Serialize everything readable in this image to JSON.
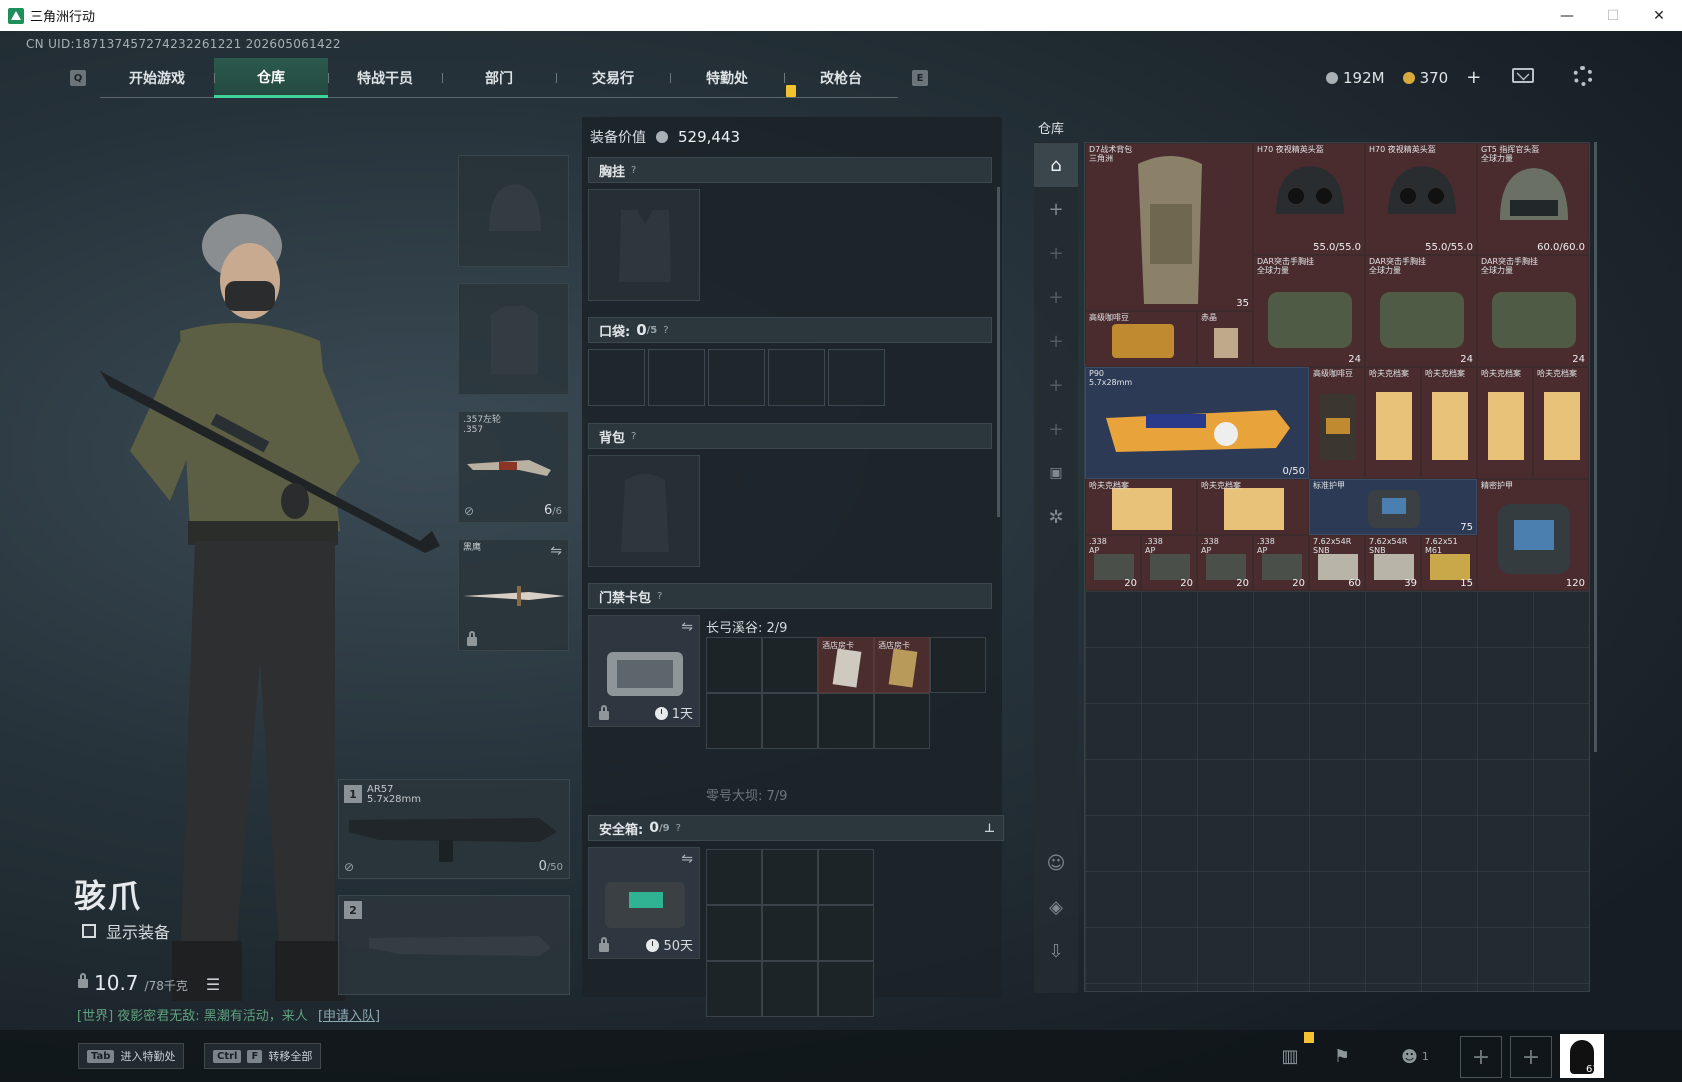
{
  "window": {
    "title": "三角洲行动",
    "controls": [
      "—",
      "☐",
      "✕"
    ]
  },
  "uid": "CN UID:187137457274232261221 202605061422",
  "nav": {
    "left_key": "Q",
    "right_key": "E",
    "tabs": [
      {
        "label": "开始游戏",
        "active": false
      },
      {
        "label": "仓库",
        "active": true
      },
      {
        "label": "特战干员",
        "active": false
      },
      {
        "label": "部门",
        "active": false
      },
      {
        "label": "交易行",
        "active": false
      },
      {
        "label": "特勤处",
        "active": false
      },
      {
        "label": "改枪台",
        "active": false
      }
    ]
  },
  "currency": {
    "hafcoin": "192M",
    "coupon": "370",
    "coupon_add": "+"
  },
  "character": {
    "name": "骇爪",
    "show_equipment": "显示装备",
    "weight": "10.7",
    "weight_max": "/78千克"
  },
  "chat": {
    "channel": "[世界]",
    "message": "夜影密君无敌: 黑潮有活动，来人",
    "link": "[申请入队]"
  },
  "equipment": {
    "pistol": {
      "name": ".357左轮",
      "sub": ".357",
      "ammo": "6",
      "ammo_max": "/6"
    },
    "melee": {
      "name": "黑鹰"
    },
    "primary": {
      "slot": "1",
      "name": "AR57",
      "caliber": "5.7x28mm",
      "ammo": "0",
      "ammo_max": "/50"
    },
    "secondary": {
      "slot": "2"
    }
  },
  "loadout": {
    "value_label": "装备价值",
    "value": "529,443",
    "sections": {
      "chest_rig": "胸挂",
      "pockets": "口袋: ",
      "pockets_count": "0",
      "pockets_max": "/5",
      "backpack": "背包",
      "keycard": "门禁卡包",
      "safebox": "安全箱: ",
      "safebox_count": "0",
      "safebox_max": "/9"
    },
    "keycard_case": {
      "duration": "1天"
    },
    "key_groups": [
      {
        "label": "长弓溪谷: 2/9"
      },
      {
        "label": "零号大坝: 7/9"
      }
    ],
    "keys": [
      {
        "label": "酒店房卡"
      },
      {
        "label": "酒店房卡"
      }
    ],
    "safebox_duration": "50天",
    "help": "?"
  },
  "warehouse": {
    "title": "仓库",
    "items": [
      {
        "label": "D7战术背包",
        "sub": "三角洲",
        "qty": "35"
      },
      {
        "label": "H70 夜视精英头盔",
        "qty": "55.0/55.0"
      },
      {
        "label": "H70 夜视精英头盔",
        "qty": "55.0/55.0"
      },
      {
        "label": "GT5 指挥官头盔",
        "sub": "全球力量",
        "qty": "60.0/60.0"
      },
      {
        "label": "DAR突击手胸挂",
        "sub": "全球力量",
        "qty": "24"
      },
      {
        "label": "DAR突击手胸挂",
        "sub": "全球力量",
        "qty": "24"
      },
      {
        "label": "DAR突击手胸挂",
        "sub": "全球力量",
        "qty": "24"
      },
      {
        "label": "高级咖啡豆",
        "qty": ""
      },
      {
        "label": "赤晶",
        "qty": ""
      },
      {
        "label": "P90",
        "sub": "5.7x28mm",
        "qty": "0/50"
      },
      {
        "label": "高级咖啡豆",
        "qty": ""
      },
      {
        "label": "哈夫克档案",
        "qty": ""
      },
      {
        "label": "哈夫克档案",
        "qty": ""
      },
      {
        "label": "哈夫克档案",
        "qty": ""
      },
      {
        "label": "哈夫克档案",
        "qty": ""
      },
      {
        "label": "哈夫克档案",
        "qty": ""
      },
      {
        "label": "哈夫克档案",
        "qty": ""
      },
      {
        "label": "标准护甲",
        "qty": "75"
      },
      {
        "label": "精密护甲",
        "qty": "120"
      },
      {
        "label": ".338",
        "sub": "AP",
        "qty": "20"
      },
      {
        "label": ".338",
        "sub": "AP",
        "qty": "20"
      },
      {
        "label": ".338",
        "sub": "AP",
        "qty": "20"
      },
      {
        "label": ".338",
        "sub": "AP",
        "qty": "20"
      },
      {
        "label": "7.62x54R",
        "sub": "SNB",
        "qty": "60"
      },
      {
        "label": "7.62x54R",
        "sub": "SNB",
        "qty": "39"
      },
      {
        "label": "7.62x51",
        "sub": "M61",
        "qty": "15"
      }
    ]
  },
  "bottom": {
    "hint1_key": "Tab",
    "hint1": "进入特勤处",
    "hint2_key1": "Ctrl",
    "hint2_key2": "F",
    "hint2": "转移全部",
    "friends": "1",
    "level": "61"
  },
  "colors": {
    "accent": "#3fd39a",
    "gold_item": "#4a2c2f",
    "blue_item": "#2c3a55",
    "alert": "#f2c230"
  }
}
